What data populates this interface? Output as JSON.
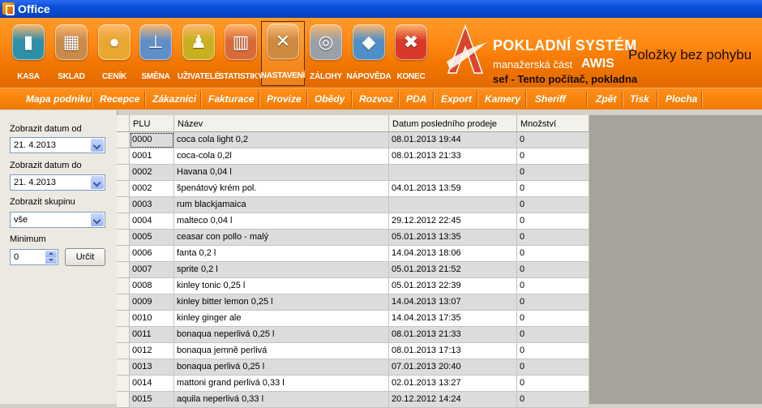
{
  "window": {
    "title": "Office"
  },
  "toolbar": {
    "buttons": [
      {
        "label": "KASA",
        "icon": "cash-register-icon",
        "color": "#2f8fa8",
        "glyph": "▮"
      },
      {
        "label": "SKLAD",
        "icon": "warehouse-boxes-icon",
        "color": "#c98a4a",
        "glyph": "▦"
      },
      {
        "label": "CENÍK",
        "icon": "coins-icon",
        "color": "#e8a830",
        "glyph": "●"
      },
      {
        "label": "SMĚNA",
        "icon": "shirt-tie-icon",
        "color": "#5f8fc8",
        "glyph": "⊥"
      },
      {
        "label": "UŽIVATELÉ",
        "icon": "user-running-icon",
        "color": "#c8b020",
        "glyph": "♟"
      },
      {
        "label": "STATISTIKY",
        "icon": "bar-chart-icon",
        "color": "#d86a3a",
        "glyph": "▥"
      },
      {
        "label": "NASTAVENÍ",
        "icon": "tools-settings-icon",
        "color": "#cf8a40",
        "glyph": "✕"
      },
      {
        "label": "ZÁLOHY",
        "icon": "disc-backup-icon",
        "color": "#9aa0a8",
        "glyph": "◎"
      },
      {
        "label": "NÁPOVĚDA",
        "icon": "help-globe-icon",
        "color": "#4f8fc8",
        "glyph": "◆"
      },
      {
        "label": "KONEC",
        "icon": "close-exit-icon",
        "color": "#d83a2a",
        "glyph": "✖"
      }
    ]
  },
  "brand": {
    "title": "POKLADNÍ SYSTÉM",
    "subtitle": "manažerská část",
    "product": "AWIS",
    "user_line": "sef -  Tento počítač, pokladna",
    "section_title": "Položky bez pohybu",
    "accent": "#ff8a14"
  },
  "menu": {
    "items": [
      "Mapa podniku",
      "Recepce",
      "Zákazníci",
      "Fakturace",
      "Provize",
      "Obědy",
      "Rozvoz",
      "PDA",
      "Export",
      "Kamery",
      "Sheriff",
      "Zpět",
      "Tisk",
      "Plocha"
    ]
  },
  "filters": {
    "date_from_label": "Zobrazit datum od",
    "date_from_value": "21. 4.2013",
    "date_to_label": "Zobrazit datum do",
    "date_to_value": "21. 4.2013",
    "group_label": "Zobrazit skupinu",
    "group_value": "vše",
    "minimum_label": "Minimum",
    "minimum_value": "0",
    "apply_label": "Určit"
  },
  "grid": {
    "columns": [
      "PLU",
      "Název",
      "Datum posledního prodeje",
      "Množství"
    ],
    "rows": [
      [
        "0000",
        "coca cola light 0,2",
        "08.01.2013 19:44",
        "0"
      ],
      [
        "0001",
        "coca-cola 0,2l",
        "08.01.2013 21:33",
        "0"
      ],
      [
        "0002",
        "Havana 0,04 l",
        "",
        "0"
      ],
      [
        "0002",
        "špenátový krém pol.",
        "04.01.2013 13:59",
        "0"
      ],
      [
        "0003",
        "rum blackjamaica",
        "",
        "0"
      ],
      [
        "0004",
        "malteco 0,04 l",
        "29.12.2012 22:45",
        "0"
      ],
      [
        "0005",
        "ceasar con pollo - malý",
        "05.01.2013 13:35",
        "0"
      ],
      [
        "0006",
        "fanta 0,2 l",
        "14.04.2013 18:06",
        "0"
      ],
      [
        "0007",
        "sprite 0,2 l",
        "05.01.2013 21:52",
        "0"
      ],
      [
        "0008",
        "kinley tonic 0,25 l",
        "05.01.2013 22:39",
        "0"
      ],
      [
        "0009",
        "kinley bitter lemon 0,25 l",
        "14.04.2013 13:07",
        "0"
      ],
      [
        "0010",
        "kinley ginger ale",
        "14.04.2013 17:35",
        "0"
      ],
      [
        "0011",
        "bonaqua neperlivá 0,25 l",
        "08.01.2013 21:33",
        "0"
      ],
      [
        "0012",
        "bonaqua jemně perlivá",
        "08.01.2013 17:13",
        "0"
      ],
      [
        "0013",
        "bonaqua perlivá 0,25 l",
        "07.01.2013 20:40",
        "0"
      ],
      [
        "0014",
        "mattoni grand perlivá 0,33 l",
        "02.01.2013 13:27",
        "0"
      ],
      [
        "0015",
        "aquila neperlivá 0,33 l",
        "20.12.2012 14:24",
        "0"
      ]
    ]
  }
}
